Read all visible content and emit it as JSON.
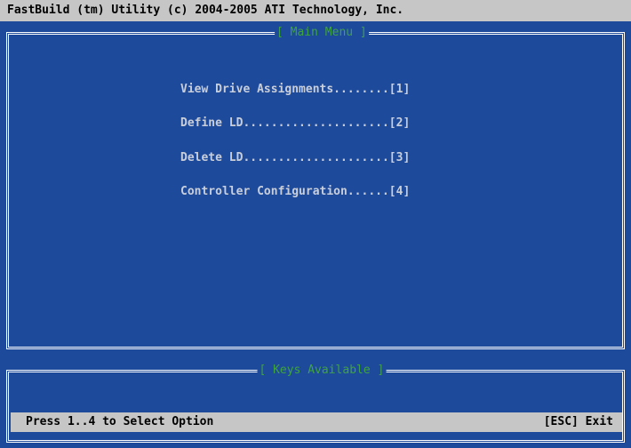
{
  "title_bar": "FastBuild (tm) Utility (c) 2004-2005 ATI Technology, Inc.",
  "main_menu": {
    "title": "[ Main Menu ]",
    "items": [
      {
        "label": "View Drive Assignments........[1]"
      },
      {
        "label": "Define LD.....................[2]"
      },
      {
        "label": "Delete LD.....................[3]"
      },
      {
        "label": "Controller Configuration......[4]"
      }
    ]
  },
  "keys_panel": {
    "title": "[ Keys Available ]",
    "left_hint": "Press 1..4 to Select Option",
    "right_hint": "[ESC] Exit"
  },
  "colors": {
    "background": "#1e4a9c",
    "bar": "#c6c6c6",
    "frame_title": "#3fa33f",
    "menu_text": "#c9cfda"
  }
}
